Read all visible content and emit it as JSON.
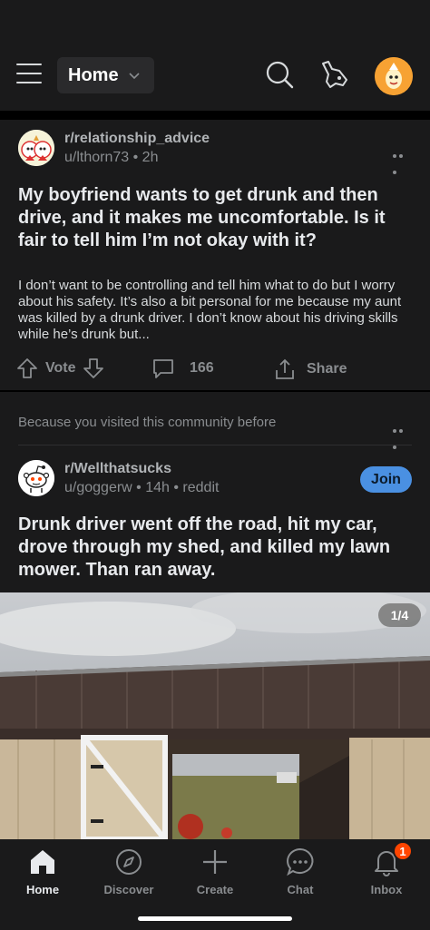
{
  "header": {
    "feed_label": "Home"
  },
  "post1": {
    "subreddit": "r/relationship_advice",
    "author": "u/lthorn73",
    "age": "2h",
    "title": "My boyfriend wants to get drunk and then drive, and it makes me uncomfortable. Is it fair to tell him I’m not okay with it?",
    "body": "I don’t want to be controlling and tell him what to do but I worry about his safety. It’s also a bit personal for me because my aunt was killed by a drunk driver. I don’t know about his driving skills while he’s drunk but...",
    "vote_label": "Vote",
    "comments": "166",
    "share_label": "Share"
  },
  "post2": {
    "recommendation": "Because you visited this community before",
    "subreddit": "r/Wellthatsucks",
    "author": "u/goggerw",
    "age": "14h",
    "source": "reddit",
    "join_label": "Join",
    "title": "Drunk driver went off the road, hit my car, drove through my shed, and killed my lawn mower. Than ran away.",
    "image_counter": "1/4"
  },
  "tabs": [
    {
      "label": "Home"
    },
    {
      "label": "Discover"
    },
    {
      "label": "Create"
    },
    {
      "label": "Chat"
    },
    {
      "label": "Inbox",
      "badge": "1"
    }
  ],
  "colors": {
    "background": "#1a1a1b",
    "accent": "#ff4500",
    "join": "#4a90e2"
  }
}
